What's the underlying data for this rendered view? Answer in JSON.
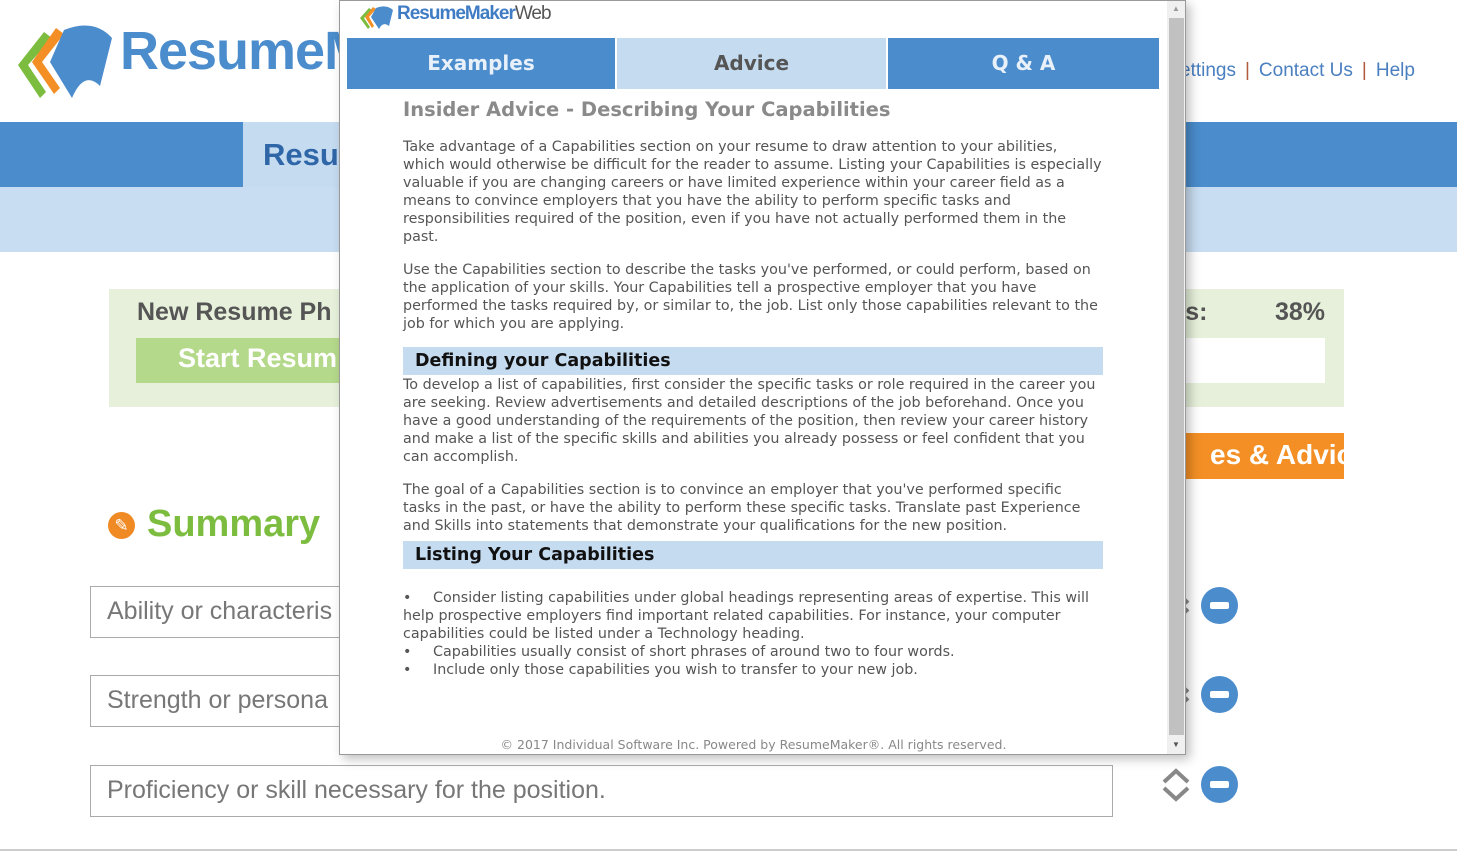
{
  "background": {
    "logo_text": "ResumeMa",
    "top_links": [
      "ettings",
      "Contact Us",
      "Help"
    ],
    "nav_tab": "Resu",
    "phase_label": "New Resume Ph",
    "start_button": "Start Resum",
    "status_label": "us:",
    "progress_percent": "38%",
    "advice_button": "es & Advice",
    "section_title": "Summary",
    "inputs": [
      {
        "placeholder": "Ability or characteris"
      },
      {
        "placeholder": "Strength or persona"
      },
      {
        "placeholder": "Proficiency or skill necessary for the position."
      }
    ],
    "colors": {
      "brand_blue": "#4a8ccc",
      "green": "#7cbd3f",
      "orange": "#f38f25"
    }
  },
  "popup": {
    "logo": {
      "main": "ResumeMaker",
      "suffix": "Web"
    },
    "tabs": [
      {
        "label": "Examples",
        "active": false
      },
      {
        "label": "Advice",
        "active": true
      },
      {
        "label": "Q & A",
        "active": false
      }
    ],
    "title": "Insider Advice - Describing Your Capabilities",
    "intro": [
      "Take advantage of a Capabilities section on your resume to draw attention to your abilities, which would otherwise be difficult for the reader to assume. Listing your Capabilities is especially valuable if you are changing careers or have limited experience within your career field as a means to convince employers that you have the ability to perform specific tasks and responsibilities required of the position, even if you have not actually performed them in the past.",
      "Use the Capabilities section to describe the tasks you've performed, or could perform, based on the application of your skills. Your Capabilities tell a prospective employer that you have performed the tasks required by, or similar to, the job. List only those capabilities relevant to the job for which you are applying."
    ],
    "section1": {
      "heading": "Defining your Capabilities",
      "paragraphs": [
        "To develop a list of capabilities, first consider the specific tasks or role required in the career you are seeking. Review advertisements and detailed descriptions of the job beforehand. Once you have a good understanding of the requirements of the position, then review your career history and make a list of the specific skills and abilities you already possess or feel confident that you can accomplish.",
        "The goal of a Capabilities section is to convince an employer that you've performed specific tasks in the past, or have the ability to perform these specific tasks. Translate past Experience and Skills into statements that demonstrate your qualifications for the new position."
      ]
    },
    "section2": {
      "heading": "Listing Your Capabilities",
      "bullets": [
        "Consider listing capabilities under global headings representing areas of expertise. This will help prospective employers find important related capabilities. For instance, your computer capabilities could be listed under a Technology heading.",
        "Capabilities usually consist of short phrases of around two to four words.",
        "Include only those capabilities you wish to transfer to your new job."
      ]
    },
    "footer": "© 2017 Individual Software Inc. Powered by ResumeMaker®. All rights reserved."
  }
}
